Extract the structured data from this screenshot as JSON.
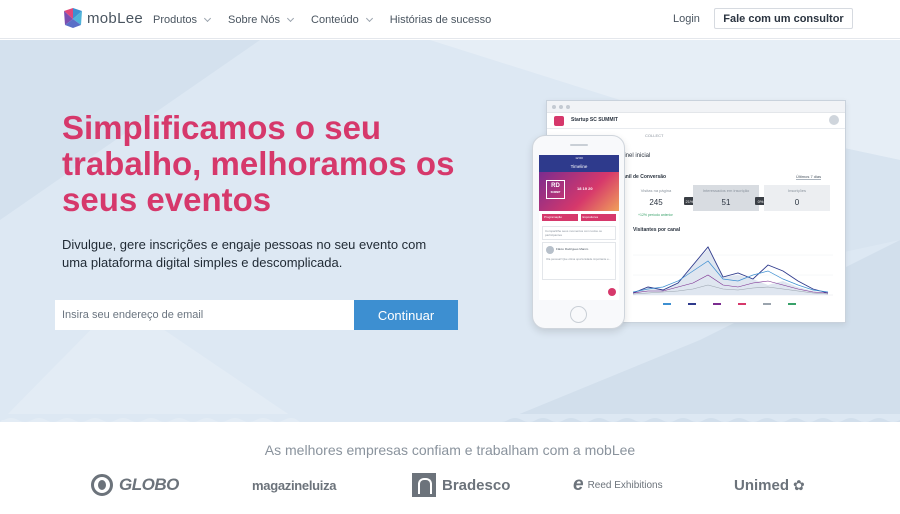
{
  "header": {
    "logo_text": "mobLee",
    "nav": [
      {
        "label": "Produtos",
        "has_dropdown": true
      },
      {
        "label": "Sobre Nós",
        "has_dropdown": true
      },
      {
        "label": "Conteúdo",
        "has_dropdown": true
      },
      {
        "label": "Histórias de sucesso",
        "has_dropdown": false
      }
    ],
    "login_label": "Login",
    "consult_label": "Fale com um consultor"
  },
  "hero": {
    "headline": "Simplificamos o seu trabalho, melhoramos os seus eventos",
    "subtitle": "Divulgue, gere inscrições e engaje pessoas no seu evento com uma plataforma digital simples e descomplicada.",
    "email_placeholder": "Insira seu endereço de email",
    "cta_label": "Continuar"
  },
  "dashboard_mock": {
    "event_name": "Startup SC SUMMIT",
    "tab": "COLLECT",
    "title": "ainel inicial",
    "funnel_label": "anil de Conversão",
    "period": "Últimos 7 dias",
    "stages": [
      {
        "label": "Visitas na página",
        "value": "245"
      },
      {
        "label": "Interessados em inscrição",
        "value": "51"
      },
      {
        "label": "Inscrições",
        "value": "0"
      }
    ],
    "conversions": [
      "21%",
      "0%"
    ],
    "note": "+12% período anterior",
    "visits_title": "Visitantes por canal"
  },
  "phone_mock": {
    "status": "12:00",
    "header": "Timeline",
    "banner_logo": "RD",
    "banner_logo_sub": "SUMMIT",
    "banner_date": "18 19 20",
    "buttons": [
      "Programação",
      "Expositores"
    ],
    "post_text": "Compartilhe seus momentos com todos os participantes",
    "author": "Flávio Rodrigues Manzo",
    "post_body": "Ola pessoal! Que ótima oportunidade importante e..."
  },
  "partners": {
    "title": "As melhores empresas confiam e trabalham com a mobLee",
    "logos": [
      "GLOBO",
      "magazineluiza",
      "Bradesco",
      "Reed Exhibitions",
      "Unimed"
    ]
  },
  "colors": {
    "accent_pink": "#d6386b",
    "cta_blue": "#3d8fd1",
    "hero_bg": "#dde8f3"
  }
}
